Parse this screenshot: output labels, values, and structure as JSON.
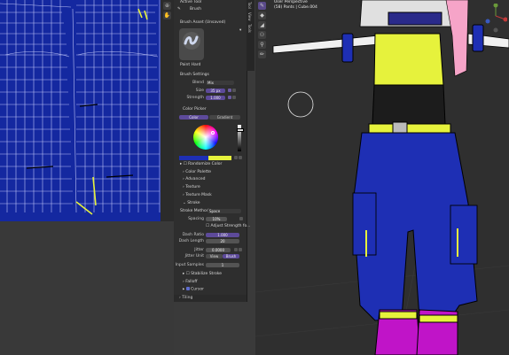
{
  "viewport": {
    "title": "User Perspective",
    "object": "(58) Pants | Cube.004"
  },
  "tabs": [
    "Tool",
    "View",
    "Tools"
  ],
  "active_tool": {
    "header": "Active Tool",
    "name": "Brush"
  },
  "brush_asset": {
    "header": "Brush Asset (Unsaved)",
    "name": "Paint Hard"
  },
  "brush_settings": {
    "header": "Brush Settings",
    "blend_label": "Blend",
    "blend_value": "Mix",
    "size_label": "Size",
    "size_value": "35 px",
    "strength_label": "Strength",
    "strength_value": "1.000"
  },
  "color_picker": {
    "header": "Color Picker",
    "tab_color": "Color",
    "tab_gradient": "Gradient",
    "primary_color": "#1e2fb4",
    "secondary_color": "#e6f23c"
  },
  "collapsed_sections": [
    "Randomize Color",
    "Color Palette",
    "Advanced",
    "Texture",
    "Texture Mask"
  ],
  "stroke": {
    "header": "Stroke",
    "method_label": "Stroke Method",
    "method_value": "Space",
    "spacing_label": "Spacing",
    "spacing_value": "10%",
    "adjust_label": "Adjust Strength fo...",
    "dash_ratio_label": "Dash Ratio",
    "dash_ratio_value": "1.000",
    "dash_length_label": "Dash Length",
    "dash_length_value": "20",
    "jitter_label": "Jitter",
    "jitter_value": "0.0000",
    "jitter_unit_label": "Jitter Unit",
    "jitter_unit_view": "View",
    "jitter_unit_brush": "Brush",
    "input_samples_label": "Input Samples",
    "input_samples_value": "1",
    "stabilize_label": "Stabilize Stroke",
    "falloff_label": "Falloff",
    "cursor_label": "Cursor"
  },
  "tiling": "Tiling",
  "colors": {
    "uv_background": "#1428a0",
    "panel_bg": "#2e2e2e",
    "accent_purple": "#5d4a9a",
    "yellow": "#e6f23c",
    "blue": "#1e2fb4",
    "magenta": "#c014c8"
  }
}
